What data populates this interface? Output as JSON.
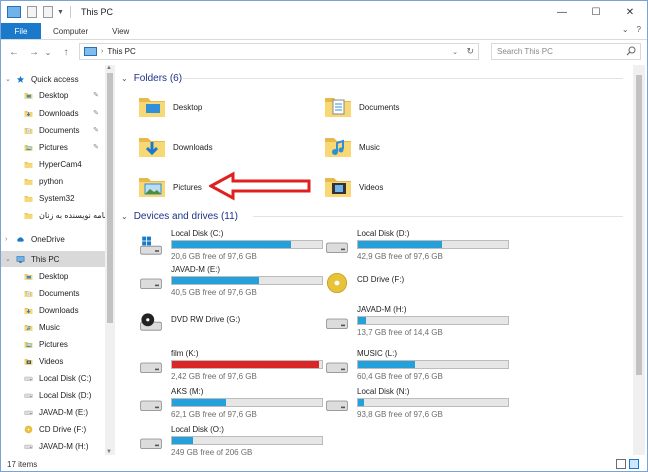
{
  "window": {
    "title": "This PC",
    "controls": {
      "minimize": "—",
      "maximize": "☐",
      "close": "✕"
    }
  },
  "ribbon": {
    "tabs": [
      "File",
      "Computer",
      "View"
    ],
    "expand_glyph": "⌄",
    "help_glyph": "?"
  },
  "address": {
    "back_glyph": "←",
    "forward_glyph": "→",
    "recent_glyph": "⌄",
    "up_glyph": "↑",
    "separator": "›",
    "path": "This PC",
    "dropdown_glyph": "⌄",
    "refresh_glyph": "↻"
  },
  "search": {
    "placeholder": "Search This PC"
  },
  "nav": {
    "items": [
      {
        "label": "Quick access",
        "icon": "star-icon",
        "pinned": false
      },
      {
        "label": "Desktop",
        "icon": "desktop-folder-icon",
        "pinned": true
      },
      {
        "label": "Downloads",
        "icon": "download-icon",
        "pinned": true
      },
      {
        "label": "Documents",
        "icon": "documents-icon",
        "pinned": true
      },
      {
        "label": "Pictures",
        "icon": "pictures-icon",
        "pinned": true
      },
      {
        "label": "HyperCam4",
        "icon": "folder-icon",
        "pinned": false
      },
      {
        "label": "python",
        "icon": "folder-icon",
        "pinned": false
      },
      {
        "label": "System32",
        "icon": "folder-icon",
        "pinned": false
      },
      {
        "label": "نامه نویسنده به زنان",
        "icon": "folder-icon",
        "pinned": false
      },
      {
        "label": "OneDrive",
        "icon": "cloud-icon",
        "pinned": false
      },
      {
        "label": "This PC",
        "icon": "computer-icon",
        "pinned": false
      },
      {
        "label": "Desktop",
        "icon": "desktop-folder-icon",
        "pinned": false
      },
      {
        "label": "Documents",
        "icon": "documents-icon",
        "pinned": false
      },
      {
        "label": "Downloads",
        "icon": "download-icon",
        "pinned": false
      },
      {
        "label": "Music",
        "icon": "music-icon",
        "pinned": false
      },
      {
        "label": "Pictures",
        "icon": "pictures-icon",
        "pinned": false
      },
      {
        "label": "Videos",
        "icon": "videos-icon",
        "pinned": false
      },
      {
        "label": "Local Disk (C:)",
        "icon": "drive-icon",
        "pinned": false
      },
      {
        "label": "Local Disk (D:)",
        "icon": "drive-icon",
        "pinned": false
      },
      {
        "label": "JAVAD-M (E:)",
        "icon": "drive-icon",
        "pinned": false
      },
      {
        "label": "CD Drive (F:)",
        "icon": "cd-icon",
        "pinned": false
      },
      {
        "label": "JAVAD-M (H:)",
        "icon": "drive-icon",
        "pinned": false
      }
    ],
    "pin_glyph": "✎",
    "expand_glyph": "›",
    "collapse_glyph": "⌄",
    "scroll_up": "▲",
    "scroll_down": "▼"
  },
  "folders": {
    "heading": "Folders (6)",
    "items": [
      {
        "label": "Desktop",
        "icon": "desktop-folder-icon"
      },
      {
        "label": "Documents",
        "icon": "documents-icon"
      },
      {
        "label": "Downloads",
        "icon": "download-icon"
      },
      {
        "label": "Music",
        "icon": "music-icon"
      },
      {
        "label": "Pictures",
        "icon": "pictures-icon"
      },
      {
        "label": "Videos",
        "icon": "videos-icon"
      }
    ]
  },
  "drives": {
    "heading": "Devices and drives (11)",
    "items": [
      {
        "name": "Local Disk (C:)",
        "free": "20,6 GB free of 97,6 GB",
        "used_fraction": 0.79,
        "icon": "windows-drive-icon"
      },
      {
        "name": "Local Disk (D:)",
        "free": "42,9 GB free of 97,6 GB",
        "used_fraction": 0.56,
        "icon": "drive-icon"
      },
      {
        "name": "JAVAD-M (E:)",
        "free": "40,5 GB free of 97,6 GB",
        "used_fraction": 0.58,
        "icon": "drive-icon"
      },
      {
        "name": "CD Drive (F:)",
        "free": "",
        "used_fraction": null,
        "icon": "cd-icon"
      },
      {
        "name": "DVD RW Drive (G:)",
        "free": "",
        "used_fraction": null,
        "icon": "dvd-icon"
      },
      {
        "name": "JAVAD-M (H:)",
        "free": "13,7 GB free of 14,4 GB",
        "used_fraction": 0.05,
        "icon": "drive-icon"
      },
      {
        "name": "film (K:)",
        "free": "2,42 GB free of 97,6 GB",
        "used_fraction": 0.98,
        "icon": "drive-icon"
      },
      {
        "name": "MUSIC (L:)",
        "free": "60,4 GB free of 97,6 GB",
        "used_fraction": 0.38,
        "icon": "drive-icon"
      },
      {
        "name": "AKS (M:)",
        "free": "62,1 GB free of 97,6 GB",
        "used_fraction": 0.36,
        "icon": "drive-icon"
      },
      {
        "name": "Local Disk (N:)",
        "free": "93,8 GB free of 97,6 GB",
        "used_fraction": 0.04,
        "icon": "drive-icon"
      },
      {
        "name": "Local Disk (O:)",
        "free": "249 GB free of 206 GB",
        "used_fraction": 0.14,
        "icon": "drive-icon"
      }
    ]
  },
  "group_glyph": "⌄",
  "status": {
    "items": "17 items"
  },
  "colors": {
    "accent": "#1979ca",
    "bar_normal": "#26a0da",
    "bar_full": "#da2626",
    "arrow": "#e02020",
    "heading": "#1e3287"
  }
}
